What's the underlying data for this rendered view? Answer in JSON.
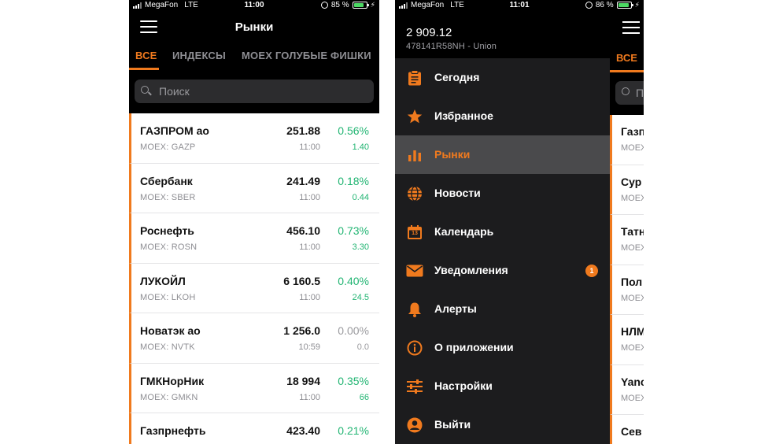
{
  "accent_color": "#f07a1e",
  "positive_color": "#22b573",
  "phone1": {
    "status": {
      "carrier": "MegaFon",
      "network": "LTE",
      "time": "11:00",
      "battery": "85 %",
      "battery_level": 0.85
    },
    "title": "Рынки",
    "tabs": [
      {
        "label": "ВСЕ",
        "active": true
      },
      {
        "label": "ИНДЕКСЫ",
        "active": false
      },
      {
        "label": "MOEX ГОЛУБЫЕ ФИШКИ",
        "active": false
      }
    ],
    "search_placeholder": "Поиск",
    "stocks": [
      {
        "name": "ГАЗПРОМ ао",
        "ticker": "MOEX: GAZP",
        "price": "251.88",
        "time": "11:00",
        "pct": "0.56%",
        "chg": "1.40",
        "trend": "up"
      },
      {
        "name": "Сбербанк",
        "ticker": "MOEX: SBER",
        "price": "241.49",
        "time": "11:00",
        "pct": "0.18%",
        "chg": "0.44",
        "trend": "up"
      },
      {
        "name": "Роснефть",
        "ticker": "MOEX: ROSN",
        "price": "456.10",
        "time": "11:00",
        "pct": "0.73%",
        "chg": "3.30",
        "trend": "up"
      },
      {
        "name": "ЛУКОЙЛ",
        "ticker": "MOEX: LKOH",
        "price": "6 160.5",
        "time": "11:00",
        "pct": "0.40%",
        "chg": "24.5",
        "trend": "up"
      },
      {
        "name": "Новатэк ао",
        "ticker": "MOEX: NVTK",
        "price": "1 256.0",
        "time": "10:59",
        "pct": "0.00%",
        "chg": "0.0",
        "trend": "flat"
      },
      {
        "name": "ГМКНорНик",
        "ticker": "MOEX: GMKN",
        "price": "18 994",
        "time": "11:00",
        "pct": "0.35%",
        "chg": "66",
        "trend": "up"
      },
      {
        "name": "Газпрнефть",
        "ticker": "",
        "price": "423.40",
        "time": "",
        "pct": "0.21%",
        "chg": "",
        "trend": "up"
      }
    ]
  },
  "phone2": {
    "status": {
      "carrier": "MegaFon",
      "network": "LTE",
      "time": "11:01",
      "battery": "86 %",
      "battery_level": 0.86
    },
    "balance": "2 909.12",
    "account": "478141R58NH - Union",
    "menu": [
      {
        "label": "Сегодня",
        "icon": "clipboard-icon",
        "active": false
      },
      {
        "label": "Избранное",
        "icon": "star-icon",
        "active": false
      },
      {
        "label": "Рынки",
        "icon": "bar-chart-icon",
        "active": true
      },
      {
        "label": "Новости",
        "icon": "globe-icon",
        "active": false
      },
      {
        "label": "Календарь",
        "icon": "calendar-icon",
        "active": false,
        "icon_text": "13"
      },
      {
        "label": "Уведомления",
        "icon": "envelope-icon",
        "active": false,
        "badge": "1"
      },
      {
        "label": "Алерты",
        "icon": "bell-icon",
        "active": false
      },
      {
        "label": "О приложении",
        "icon": "info-icon",
        "active": false
      },
      {
        "label": "Настройки",
        "icon": "sliders-icon",
        "active": false
      },
      {
        "label": "Выйти",
        "icon": "user-icon",
        "active": false
      }
    ],
    "peek": {
      "tab": "ВСЕ",
      "search_placeholder": "П",
      "rows": [
        {
          "name": "Газп",
          "ticker": "MOEX"
        },
        {
          "name": "Сур",
          "ticker": "MOEX"
        },
        {
          "name": "Татн",
          "ticker": "MOEX"
        },
        {
          "name": "Пол",
          "ticker": "MOEX"
        },
        {
          "name": "НЛМ",
          "ticker": "MOEX"
        },
        {
          "name": "Yanc",
          "ticker": "MOEX"
        },
        {
          "name": "Сев",
          "ticker": ""
        }
      ]
    }
  }
}
